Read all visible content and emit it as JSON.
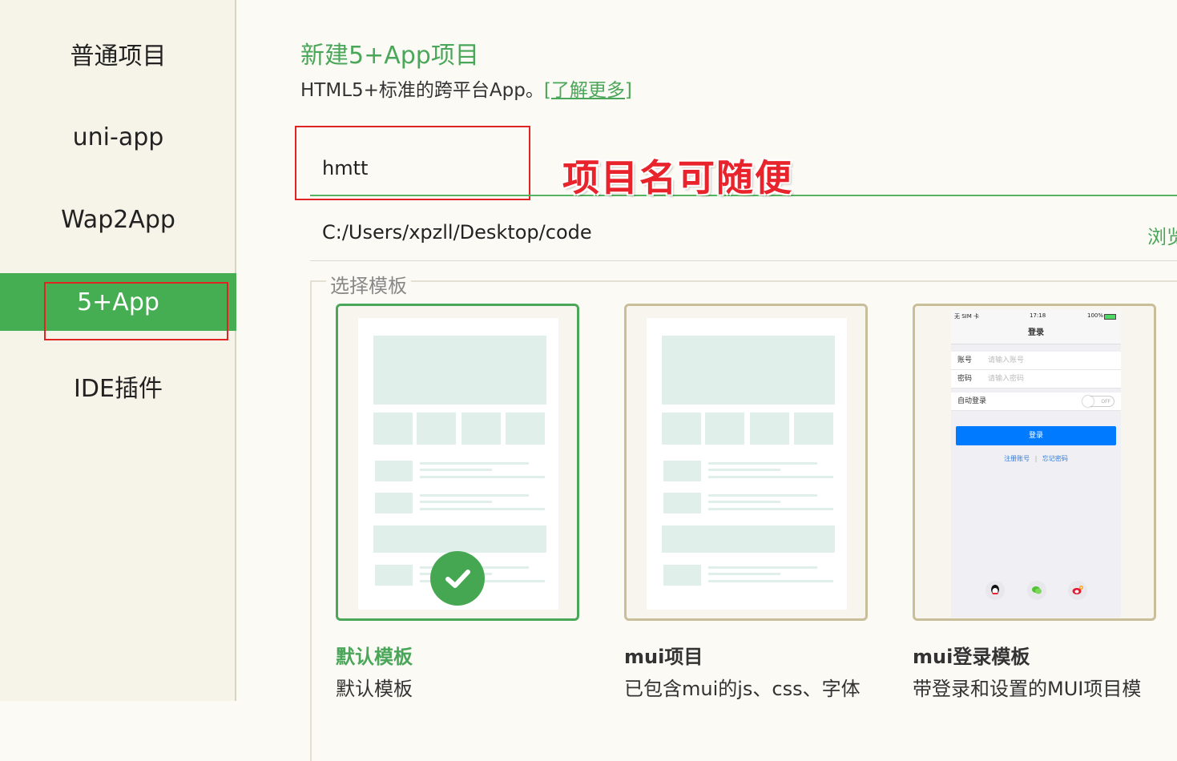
{
  "sidebar": {
    "items": [
      {
        "label": "普通项目"
      },
      {
        "label": "uni-app"
      },
      {
        "label": "Wap2App"
      },
      {
        "label": "5+App"
      },
      {
        "label": "IDE插件"
      }
    ],
    "active": "5+App"
  },
  "main": {
    "title": "新建5+App项目",
    "subtitle": "HTML5+标准的跨平台App。",
    "learn_more": "[了解更多]",
    "project_name": "hmtt",
    "annotation": "项目名可随便",
    "path": "C:/Users/xpzll/Desktop/code",
    "browse_label": "浏览",
    "template_legend": "选择模板"
  },
  "templates": [
    {
      "title": "默认模板",
      "desc": "默认模板",
      "selected": true
    },
    {
      "title": "mui项目",
      "desc": "已包含mui的js、css、字体",
      "selected": false
    },
    {
      "title": "mui登录模板",
      "desc": "带登录和设置的MUI项目模",
      "selected": false
    }
  ],
  "phone_preview": {
    "carrier": "无 SIM 卡",
    "time": "17:18",
    "battery": "100%",
    "nav_title": "登录",
    "account_label": "账号",
    "account_placeholder": "请输入账号",
    "password_label": "密码",
    "password_placeholder": "请输入密码",
    "auto_login_label": "自动登录",
    "toggle_text": "OFF",
    "login_button": "登录",
    "register_link": "注册账号",
    "separator": "|",
    "forgot_link": "忘记密码"
  },
  "colors": {
    "accent": "#45ad52",
    "annotation": "#e8232b",
    "link": "#2f7bd9"
  }
}
